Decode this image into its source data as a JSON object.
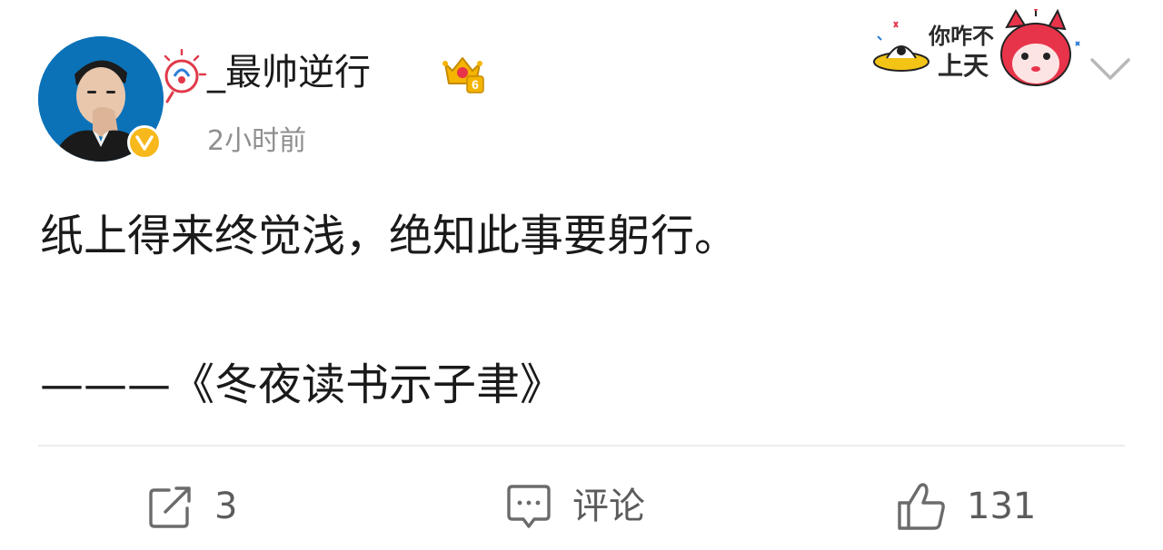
{
  "post": {
    "author": {
      "name": "_最帅逆行",
      "verified": true,
      "badge_level": "6"
    },
    "time": "2小时前",
    "sticker": {
      "text_line1": "你咋不",
      "text_line2": "上天"
    },
    "content": {
      "line1": "纸上得来终觉浅，绝知此事要躬行。",
      "line2": "———《冬夜读书示子聿》"
    },
    "actions": {
      "repost_count": "3",
      "comment_label": "评论",
      "like_count": "131"
    }
  },
  "colors": {
    "avatar_bg": "#0b72b8",
    "verified_badge": "#f7b81b",
    "crown": "#f5b400",
    "sticker_accent": "#e8344a",
    "muted_text": "#8f8f8f",
    "action_text": "#5c5c5c"
  },
  "icons": {
    "repost": "repost-icon",
    "comment": "comment-icon",
    "like": "thumbs-up-icon",
    "more": "chevron-down-icon",
    "verified": "verified-v-icon",
    "crown": "crown-badge-icon"
  }
}
